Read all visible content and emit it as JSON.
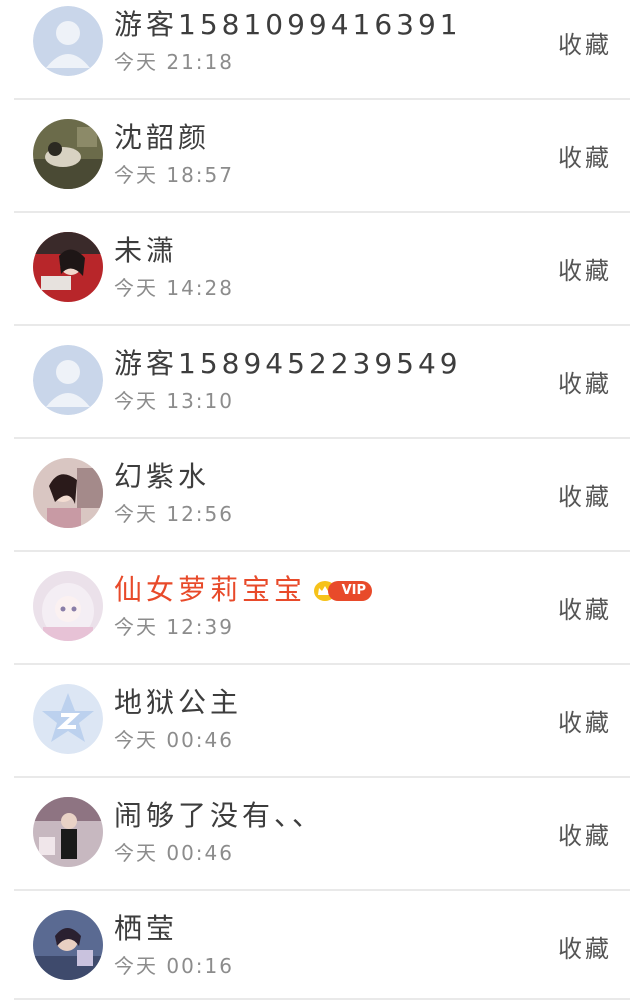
{
  "contacts": [
    {
      "name": "游客1581099416391",
      "time": "今天 21:18",
      "action": "收藏",
      "avatar": "default-user-avatar"
    },
    {
      "name": "沈韶颜",
      "time": "今天 18:57",
      "action": "收藏",
      "avatar": "user-photo-avatar"
    },
    {
      "name": "未潇",
      "time": "今天 14:28",
      "action": "收藏",
      "avatar": "user-photo-avatar"
    },
    {
      "name": "游客1589452239549",
      "time": "今天 13:10",
      "action": "收藏",
      "avatar": "default-user-avatar"
    },
    {
      "name": "幻紫水",
      "time": "今天 12:56",
      "action": "收藏",
      "avatar": "user-photo-avatar"
    },
    {
      "name": "仙女萝莉宝宝",
      "time": "今天 12:39",
      "action": "收藏",
      "avatar": "user-photo-avatar",
      "vip": "VIP"
    },
    {
      "name": "地狱公主",
      "time": "今天 00:46",
      "action": "收藏",
      "avatar": "star-logo-avatar"
    },
    {
      "name": "闹够了没有、、",
      "time": "今天 00:46",
      "action": "收藏",
      "avatar": "user-photo-avatar"
    },
    {
      "name": "栖莹",
      "time": "今天 00:16",
      "action": "收藏",
      "avatar": "user-photo-avatar"
    }
  ],
  "colors": {
    "vip_name": "#e84a2a",
    "vip_badge": "#e84a2a",
    "crown": "#f6c21a",
    "default_avatar": "#c9d6ea",
    "star_logo": "#bcd1ee"
  }
}
